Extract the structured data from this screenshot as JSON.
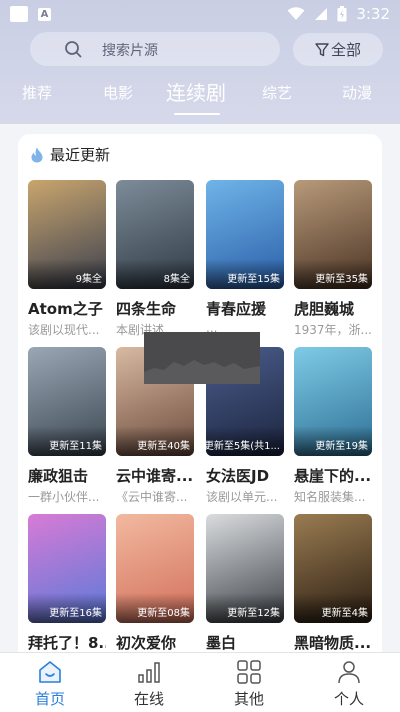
{
  "status_bar": {
    "time": "3:32",
    "icons": [
      "square-icon",
      "a-notification-icon",
      "wifi-icon",
      "signal-icon",
      "battery-icon"
    ]
  },
  "search": {
    "placeholder": "搜索片源"
  },
  "filter": {
    "label": "全部",
    "icon": "filter-icon"
  },
  "tabs": [
    {
      "label": "推荐",
      "active": false
    },
    {
      "label": "电影",
      "active": false
    },
    {
      "label": "连续剧",
      "active": true
    },
    {
      "label": "综艺",
      "active": false
    },
    {
      "label": "动漫",
      "active": false
    }
  ],
  "section": {
    "title": "最近更新",
    "icon": "flame-icon"
  },
  "items": [
    {
      "title": "Atom之子",
      "desc": "该剧以现代...",
      "badge": "9集全",
      "colors": [
        "#c9a56d",
        "#3a3f4f"
      ]
    },
    {
      "title": "四条生命",
      "desc": "本剧讲述...",
      "badge": "8集全",
      "colors": [
        "#7d8c99",
        "#2f3a45"
      ]
    },
    {
      "title": "青春应援",
      "desc": "...",
      "badge": "更新至15集",
      "colors": [
        "#6fb4e8",
        "#2a5ea8"
      ]
    },
    {
      "title": "虎胆巍城",
      "desc": "1937年，浙...",
      "badge": "更新至35集",
      "colors": [
        "#b89a7a",
        "#4a3324"
      ]
    },
    {
      "title": "廉政狙击",
      "desc": "一群小伙伴...",
      "badge": "更新至11集",
      "colors": [
        "#9aa7b4",
        "#3b4652"
      ]
    },
    {
      "title": "云中谁寄...",
      "desc": "《云中谁寄...",
      "badge": "更新至40集",
      "colors": [
        "#d8b9a1",
        "#6c4b3c"
      ]
    },
    {
      "title": "女法医JD",
      "desc": "该剧以单元...",
      "badge": "更新至5集(共1...",
      "colors": [
        "#4b5d8b",
        "#1c2540"
      ]
    },
    {
      "title": "悬崖下的...",
      "desc": "知名服装集...",
      "badge": "更新至19集",
      "colors": [
        "#7fcbe6",
        "#2d6f95"
      ]
    },
    {
      "title": "拜托了！8...",
      "desc": "",
      "badge": "更新至16集",
      "colors": [
        "#d77bd6",
        "#5a79d8"
      ]
    },
    {
      "title": "初次爱你",
      "desc": "",
      "badge": "更新至08集",
      "colors": [
        "#f2b9a0",
        "#d26f5a"
      ]
    },
    {
      "title": "墨白",
      "desc": "",
      "badge": "更新至12集",
      "colors": [
        "#d9dde0",
        "#3d4146"
      ]
    },
    {
      "title": "黑暗物质...",
      "desc": "",
      "badge": "更新至4集",
      "colors": [
        "#9a7c52",
        "#2a1d12"
      ]
    }
  ],
  "bottom_nav": [
    {
      "label": "首页",
      "icon": "home-icon",
      "active": true
    },
    {
      "label": "在线",
      "icon": "bar-chart-icon",
      "active": false
    },
    {
      "label": "其他",
      "icon": "grid-icon",
      "active": false
    },
    {
      "label": "个人",
      "icon": "person-icon",
      "active": false
    }
  ],
  "accent_color": "#2b7fd9"
}
